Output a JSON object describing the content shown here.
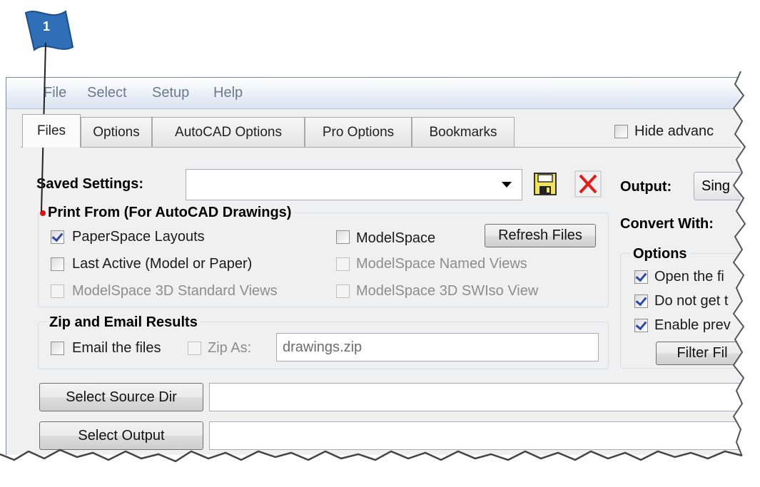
{
  "callout": {
    "number": "1"
  },
  "menu": {
    "items": [
      "File",
      "Select",
      "Setup",
      "Help"
    ]
  },
  "tabs": [
    "Files",
    "Options",
    "AutoCAD Options",
    "Pro Options",
    "Bookmarks"
  ],
  "hide_advanced": {
    "label": "Hide advanc"
  },
  "saved_settings": {
    "label": "Saved Settings:",
    "value": ""
  },
  "output": {
    "label": "Output:",
    "value": "Sing"
  },
  "print_from": {
    "title": "Print From (For AutoCAD Drawings)",
    "options": [
      {
        "label": "PaperSpace Layouts",
        "checked": true,
        "enabled": true
      },
      {
        "label": "ModelSpace",
        "checked": false,
        "enabled": true
      },
      {
        "label": "Last Active (Model or Paper)",
        "checked": false,
        "enabled": true
      },
      {
        "label": "ModelSpace Named Views",
        "checked": false,
        "enabled": false
      },
      {
        "label": "ModelSpace 3D Standard Views",
        "checked": false,
        "enabled": false
      },
      {
        "label": "ModelSpace 3D SWIso View",
        "checked": false,
        "enabled": false
      }
    ],
    "refresh_label": "Refresh Files"
  },
  "zip_email": {
    "title": "Zip and Email Results",
    "email_label": "Email the files",
    "zip_label": "Zip As:",
    "zip_value": "drawings.zip"
  },
  "convert_with": {
    "label": "Convert With:"
  },
  "options_group": {
    "title": "Options",
    "items": [
      {
        "label": "Open the fi",
        "checked": true
      },
      {
        "label": "Do not get t",
        "checked": true
      },
      {
        "label": "Enable prev",
        "checked": true
      }
    ],
    "filter_label": "Filter Fil"
  },
  "buttons": {
    "select_source": "Select Source Dir",
    "select_output": "Select Output"
  }
}
